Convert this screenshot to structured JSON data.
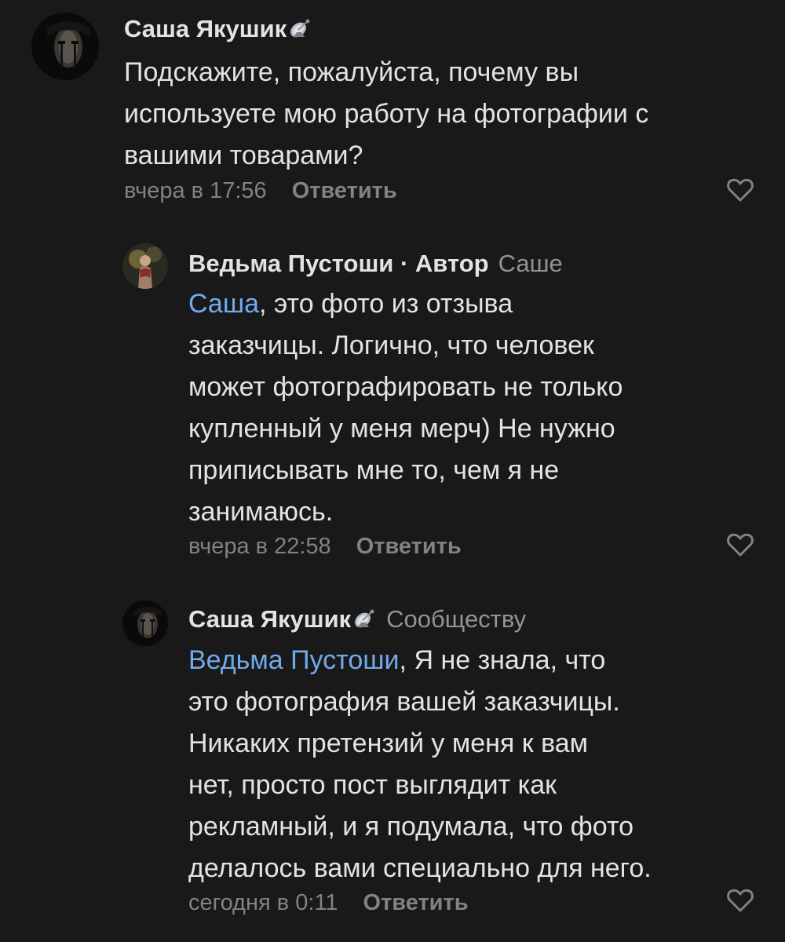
{
  "comments": [
    {
      "author": "Саша Якушик",
      "badge_icon": "satellite-dish-icon",
      "role": "",
      "reply_to": "",
      "mention": "",
      "lines": [
        "Подскажите, пожалуйста, почему вы",
        "используете мою работу на фотографии с",
        "вашими товарами?"
      ],
      "time": "вчера в 17:56",
      "reply_label": "Ответить"
    },
    {
      "author": "Ведьма Пустоши",
      "role": "· Автор",
      "reply_to": "Саше",
      "mention": "Саша",
      "first_line_rest": ", это фото из отзыва",
      "lines": [
        "заказчицы. Логично, что человек",
        "может фотографировать не только",
        "купленный у меня мерч) Не нужно",
        "приписывать мне то, чем я не",
        "занимаюсь."
      ],
      "time": "вчера в 22:58",
      "reply_label": "Ответить"
    },
    {
      "author": "Саша Якушик",
      "badge_icon": "satellite-dish-icon",
      "reply_to": "Сообществу",
      "mention": "Ведьма Пустоши",
      "first_line_rest": ", Я не знала, что",
      "lines": [
        "это фотография вашей заказчицы.",
        "Никаких претензий у меня к вам",
        "нет, просто пост выглядит как",
        "рекламный, и я подумала, что фото",
        "делалось вами специально для него."
      ],
      "time": "сегодня в 0:11",
      "reply_label": "Ответить"
    }
  ],
  "colors": {
    "background": "#19191a",
    "text": "#e1e3e6",
    "mention": "#71aaeb",
    "secondary": "#828282"
  }
}
